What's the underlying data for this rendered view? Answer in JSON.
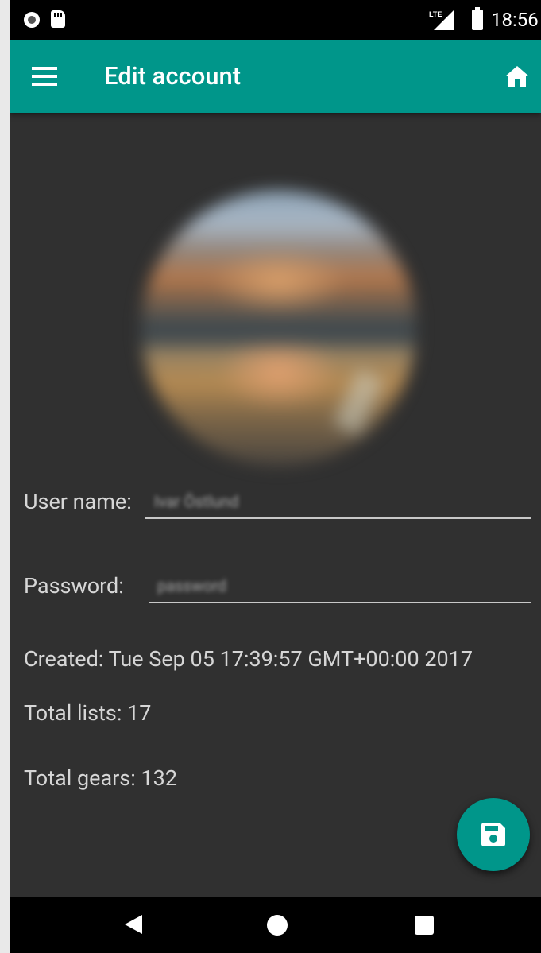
{
  "status_bar": {
    "time": "18:56",
    "network_label": "LTE",
    "icons": [
      "record-indicator-icon",
      "sd-card-icon",
      "lte-signal-icon",
      "battery-icon"
    ]
  },
  "toolbar": {
    "title": "Edit account",
    "menu_icon": "hamburger-menu-icon",
    "home_icon": "home-icon",
    "color": "#00968a"
  },
  "account": {
    "username_label": "User name:",
    "username_value": "Ivar Östlund",
    "password_label": "Password:",
    "password_value": "password",
    "created_text": "Created: Tue Sep 05 17:39:57 GMT+00:00 2017",
    "total_lists_text": "Total lists: 17",
    "total_gears_text": "Total gears: 132"
  },
  "fab": {
    "icon": "save-icon",
    "color": "#00968a"
  },
  "nav_bar": {
    "icons": [
      "back-icon",
      "home-icon",
      "recents-icon"
    ]
  }
}
